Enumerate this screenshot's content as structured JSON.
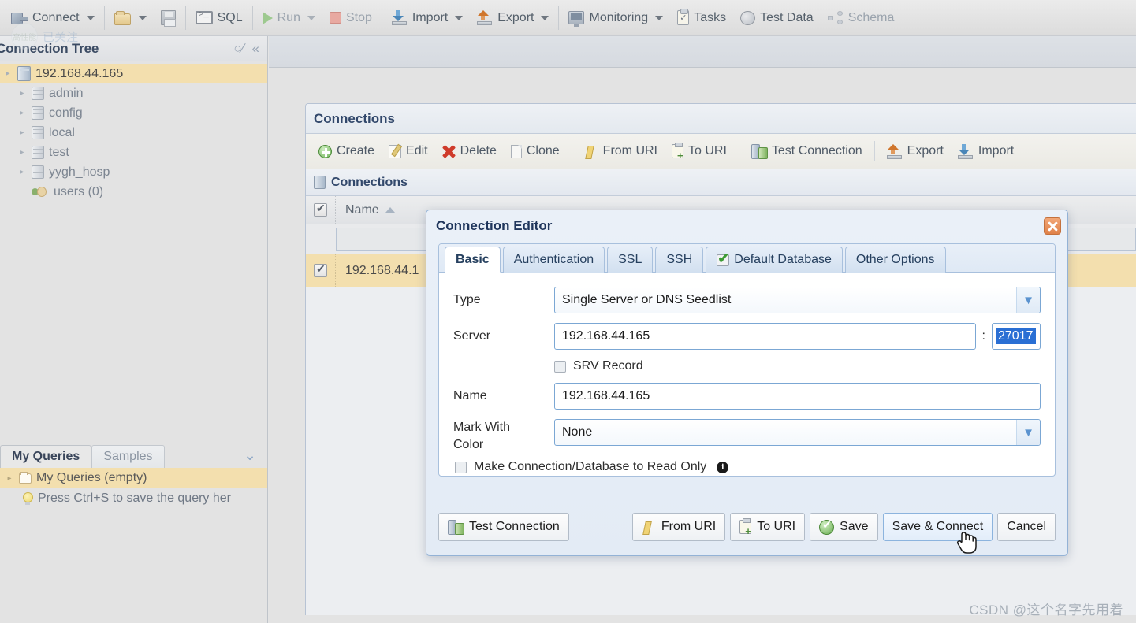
{
  "app": {
    "toolbar": [
      {
        "label": "Connect",
        "icon": "plug-icon",
        "caret": true,
        "dim": false
      },
      {
        "sep": true
      },
      {
        "label": "",
        "icon": "open-folder-icon",
        "caret": true,
        "dim": false
      },
      {
        "label": "",
        "icon": "save-disk-icon",
        "caret": false,
        "dim": true
      },
      {
        "sep": true
      },
      {
        "label": "SQL",
        "icon": "console-icon",
        "caret": false,
        "dim": false
      },
      {
        "sep": true
      },
      {
        "label": "Run",
        "icon": "run-icon",
        "caret": true,
        "dim": true
      },
      {
        "label": "Stop",
        "icon": "stop-icon",
        "caret": false,
        "dim": true
      },
      {
        "sep": true
      },
      {
        "label": "Import",
        "icon": "import-icon",
        "caret": true,
        "dim": false
      },
      {
        "label": "Export",
        "icon": "export-icon",
        "caret": true,
        "dim": false
      },
      {
        "sep": true
      },
      {
        "label": "Monitoring",
        "icon": "monitor-icon",
        "caret": true,
        "dim": false
      },
      {
        "label": "Tasks",
        "icon": "tasks-icon",
        "caret": false,
        "dim": false
      },
      {
        "label": "Test Data",
        "icon": "test-data-icon",
        "caret": false,
        "dim": false
      },
      {
        "label": "Schema",
        "icon": "schema-icon",
        "caret": false,
        "dim": true
      }
    ]
  },
  "sidebar": {
    "title": "Connection Tree",
    "search_icon": "search-icon",
    "collapse_icon": "collapse-left-icon",
    "tree": [
      {
        "label": "192.168.44.165",
        "icon": "server-icon",
        "indent": 0,
        "selected": true,
        "arrow": true
      },
      {
        "label": "admin",
        "icon": "database-icon",
        "indent": 1,
        "selected": false,
        "arrow": true
      },
      {
        "label": "config",
        "icon": "database-icon",
        "indent": 1,
        "selected": false,
        "arrow": true
      },
      {
        "label": "local",
        "icon": "database-icon",
        "indent": 1,
        "selected": false,
        "arrow": true
      },
      {
        "label": "test",
        "icon": "database-icon",
        "indent": 1,
        "selected": false,
        "arrow": true
      },
      {
        "label": "yygh_hosp",
        "icon": "database-icon",
        "indent": 1,
        "selected": false,
        "arrow": true
      },
      {
        "label": "users (0)",
        "icon": "users-icon",
        "indent": 1,
        "selected": false,
        "arrow": false
      }
    ]
  },
  "queries_panel": {
    "tabs": [
      {
        "label": "My Queries",
        "active": true
      },
      {
        "label": "Samples",
        "active": false
      }
    ],
    "expand_icon": "chevron-double-down-icon",
    "rows": [
      {
        "label": "My Queries (empty)",
        "icon": "folder-icon",
        "selected": true
      },
      {
        "label": "Press Ctrl+S to save the query her",
        "icon": "lightbulb-icon",
        "selected": false
      }
    ]
  },
  "connections_window": {
    "title": "Connections",
    "toolbar": [
      {
        "label": "Create",
        "icon": "create-icon"
      },
      {
        "label": "Edit",
        "icon": "edit-icon"
      },
      {
        "label": "Delete",
        "icon": "delete-icon"
      },
      {
        "label": "Clone",
        "icon": "clone-icon"
      },
      {
        "sep": true
      },
      {
        "label": "From URI",
        "icon": "from-uri-icon"
      },
      {
        "label": "To URI",
        "icon": "to-uri-icon"
      },
      {
        "sep": true
      },
      {
        "label": "Test Connection",
        "icon": "test-connection-icon"
      },
      {
        "sep": true
      },
      {
        "label": "Export",
        "icon": "export-icon"
      },
      {
        "label": "Import",
        "icon": "import-icon"
      }
    ],
    "table": {
      "header_label": "Connections",
      "header_icon": "database-icon",
      "columns": [
        "Name"
      ],
      "sort_column": "Name",
      "sort_direction": "asc",
      "select_all_checked": true,
      "filter_value": "",
      "rows": [
        {
          "checked": true,
          "name": "192.168.44.1"
        }
      ]
    }
  },
  "dialog": {
    "title": "Connection Editor",
    "close_icon": "close-icon",
    "tabs": [
      {
        "label": "Basic",
        "active": true,
        "icon": null
      },
      {
        "label": "Authentication",
        "active": false,
        "icon": null
      },
      {
        "label": "SSL",
        "active": false,
        "icon": null
      },
      {
        "label": "SSH",
        "active": false,
        "icon": null
      },
      {
        "label": "Default Database",
        "active": false,
        "icon": "checkmark-icon"
      },
      {
        "label": "Other Options",
        "active": false,
        "icon": null
      }
    ],
    "fields": {
      "type_label": "Type",
      "type_value": "Single Server or DNS Seedlist",
      "server_label": "Server",
      "server_value": "192.168.44.165",
      "port_separator": ":",
      "port_value": "27017",
      "srv_label": "SRV Record",
      "srv_checked": false,
      "name_label": "Name",
      "name_value": "192.168.44.165",
      "color_label_line1": "Mark With",
      "color_label_line2": "Color",
      "color_value": "None",
      "readonly_label": "Make Connection/Database to Read Only",
      "readonly_checked": false,
      "readonly_info_icon": "info-icon"
    },
    "buttons": {
      "test_connection": "Test Connection",
      "from_uri": "From URI",
      "to_uri": "To URI",
      "save": "Save",
      "save_connect": "Save & Connect",
      "cancel": "Cancel",
      "hovered": "Save & Connect"
    }
  },
  "watermarks": {
    "follow_badge": "已关注",
    "avatar_label": "高性能",
    "bottom_right": "CSDN @这个名字先用着"
  },
  "colors": {
    "selection_highlight": "#f3dfae",
    "text_selection_blue": "#2a6fd4",
    "dialog_border": "#93b2d6",
    "title_text": "#20365c",
    "close_button": "#e08149"
  }
}
